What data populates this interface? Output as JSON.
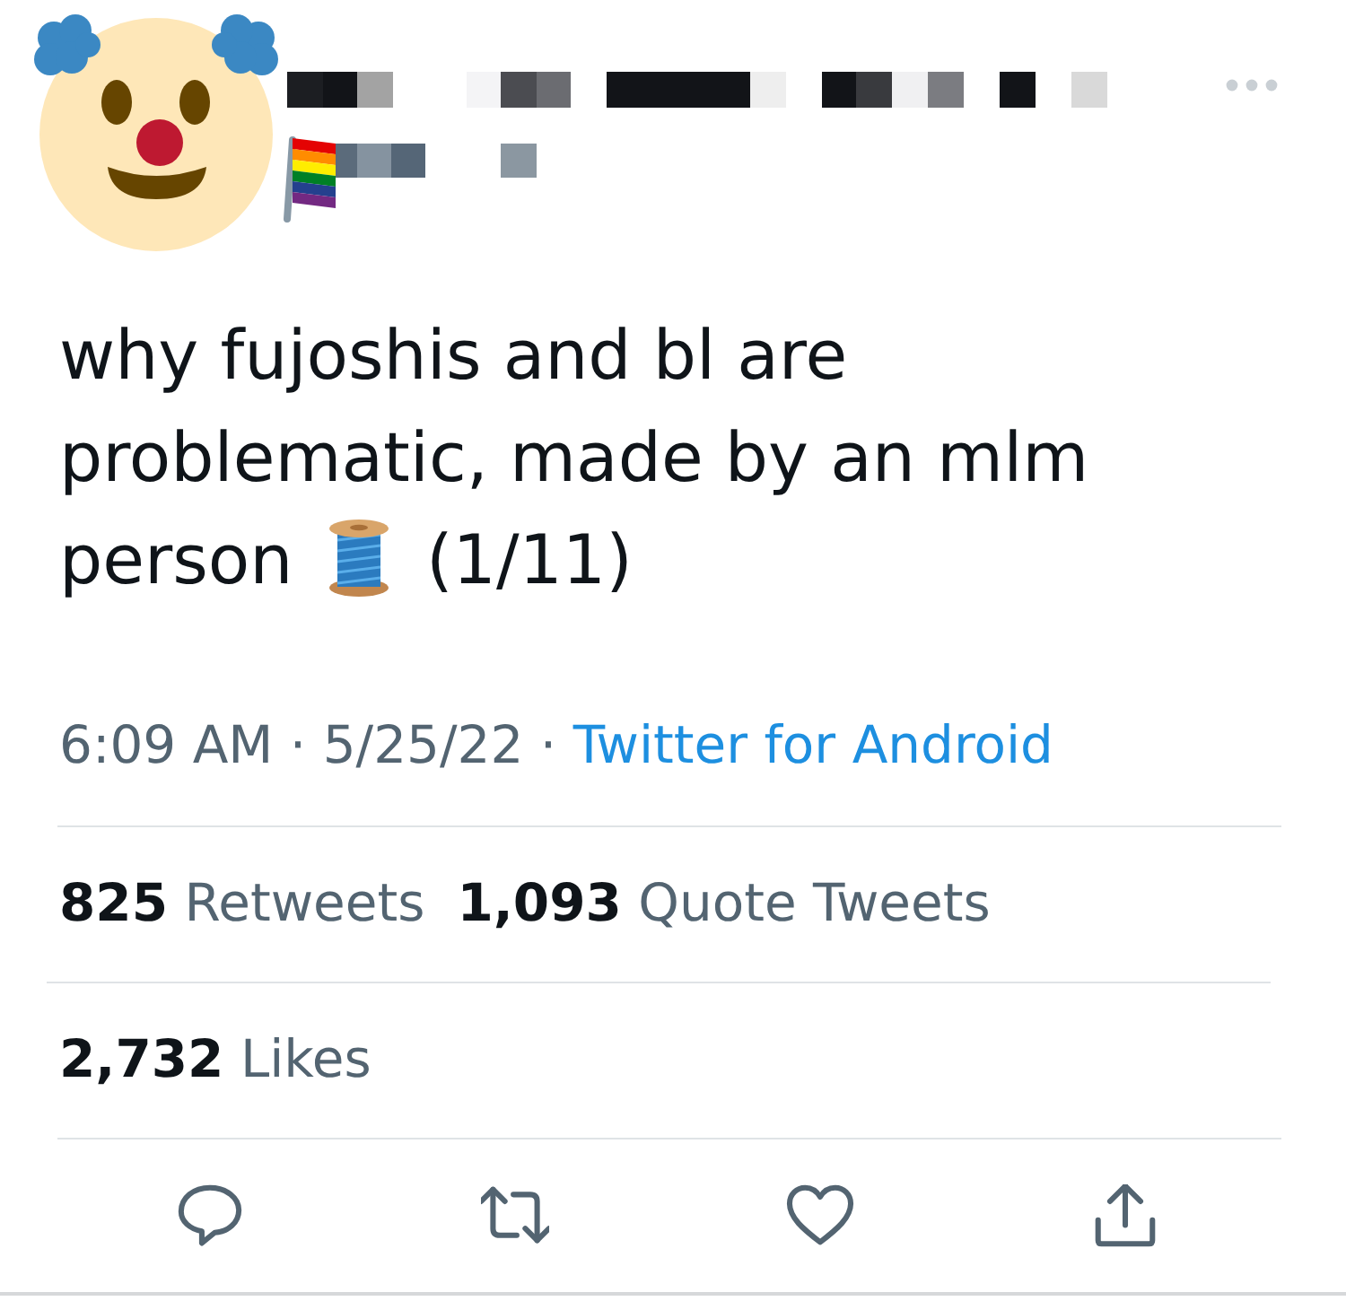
{
  "tweet": {
    "text": "why fujoshis and bl are problematic, made by an mlm person",
    "thread_counter": "(1/11)"
  },
  "meta": [
    {
      "kind": "time",
      "text": "6:09 AM"
    },
    {
      "kind": "separator",
      "text": "·"
    },
    {
      "kind": "date",
      "text": "5/25/22"
    },
    {
      "kind": "separator",
      "text": "·"
    },
    {
      "kind": "source",
      "text": "Twitter for Android"
    }
  ],
  "stat_rows": [
    {
      "items": [
        {
          "count": "825",
          "label": "Retweets"
        },
        {
          "count": "1,093",
          "label": "Quote Tweets"
        }
      ]
    },
    {
      "items": [
        {
          "count": "2,732",
          "label": "Likes"
        }
      ]
    }
  ],
  "actions": [
    {
      "kind": "reply"
    },
    {
      "kind": "retweet"
    },
    {
      "kind": "like"
    },
    {
      "kind": "share"
    }
  ]
}
